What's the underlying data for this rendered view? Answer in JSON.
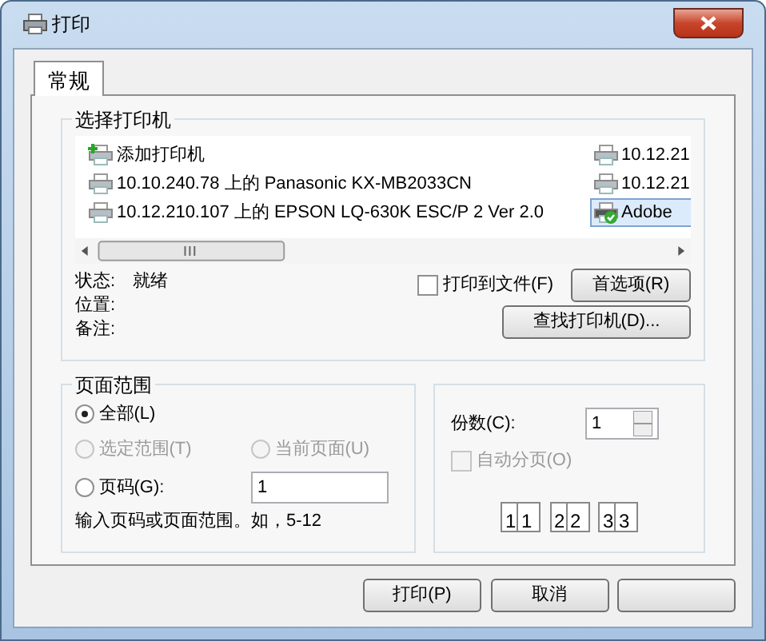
{
  "window": {
    "title": "打印"
  },
  "tabs": [
    {
      "label": "常规",
      "selected": true
    }
  ],
  "printer_group": {
    "title": "选择打印机",
    "printers": [
      {
        "name": "添加打印机",
        "kind": "add",
        "selected": false
      },
      {
        "name": "10.10.240.78 上的 Panasonic KX-MB2033CN",
        "kind": "printer",
        "selected": false
      },
      {
        "name": "10.12.210.107 上的 EPSON LQ-630K ESC/P 2 Ver 2.0",
        "kind": "printer",
        "selected": false
      },
      {
        "name": "10.12.21",
        "kind": "printer",
        "selected": false
      },
      {
        "name": "10.12.21",
        "kind": "printer",
        "selected": false
      },
      {
        "name": "Adobe",
        "kind": "default",
        "selected": true
      }
    ],
    "status_fields": [
      {
        "label": "状态:",
        "value": "就绪"
      },
      {
        "label": "位置:"
      },
      {
        "label": "备注:"
      }
    ],
    "print_to_file": {
      "label": "打印到文件(F)",
      "checked": false
    },
    "buttons": [
      "首选项(R)",
      "查找打印机(D)..."
    ]
  },
  "page_range": {
    "title": "页面范围",
    "options": [
      {
        "label": "全部(L)",
        "selected": true,
        "disabled": false
      },
      {
        "label": "选定范围(T)",
        "selected": false,
        "disabled": true
      },
      {
        "label": "当前页面(U)",
        "selected": false,
        "disabled": true
      },
      {
        "label": "页码(G):",
        "selected": false,
        "disabled": false
      }
    ],
    "pages_value": "1",
    "hint": "输入页码或页面范围。如，5-12"
  },
  "copies": {
    "label": "份数(C):",
    "value": "1",
    "collate": {
      "label": "自动分页(O)",
      "checked": false,
      "disabled": true
    },
    "collate_pages": [
      "1",
      "1",
      "2",
      "2",
      "3",
      "3"
    ]
  },
  "buttons": [
    "打印(P)",
    "取消"
  ]
}
